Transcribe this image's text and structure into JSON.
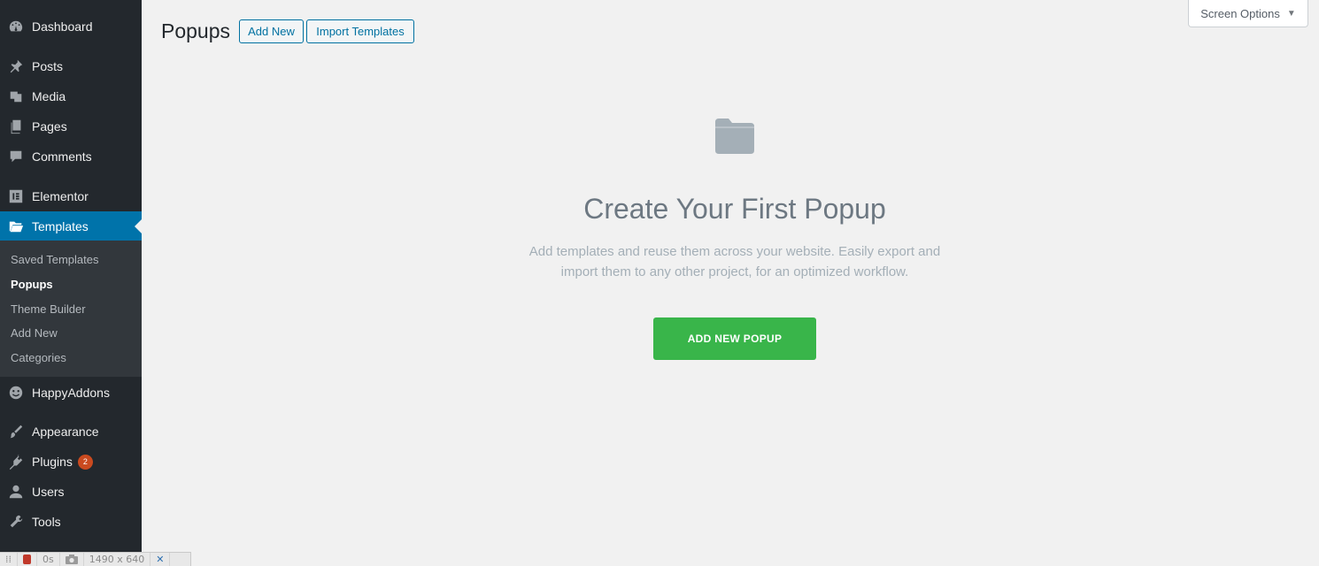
{
  "sidebar": {
    "items": [
      {
        "label": "Dashboard",
        "icon": "dashboard-icon"
      },
      {
        "label": "Posts",
        "icon": "pin-icon"
      },
      {
        "label": "Media",
        "icon": "media-icon"
      },
      {
        "label": "Pages",
        "icon": "pages-icon"
      },
      {
        "label": "Comments",
        "icon": "comment-icon"
      },
      {
        "label": "Elementor",
        "icon": "elementor-icon"
      },
      {
        "label": "Templates",
        "icon": "folder-open-icon",
        "active": true
      },
      {
        "label": "HappyAddons",
        "icon": "happyaddons-icon"
      },
      {
        "label": "Appearance",
        "icon": "brush-icon"
      },
      {
        "label": "Plugins",
        "icon": "plugin-icon",
        "badge": "2"
      },
      {
        "label": "Users",
        "icon": "user-icon"
      },
      {
        "label": "Tools",
        "icon": "wrench-icon"
      }
    ],
    "submenu": [
      {
        "label": "Saved Templates"
      },
      {
        "label": "Popups",
        "current": true
      },
      {
        "label": "Theme Builder"
      },
      {
        "label": "Add New"
      },
      {
        "label": "Categories"
      }
    ]
  },
  "header": {
    "title": "Popups",
    "add_new_label": "Add New",
    "import_label": "Import Templates",
    "screen_options_label": "Screen Options"
  },
  "empty_state": {
    "title": "Create Your First Popup",
    "description_line1": "Add templates and reuse them across your website. Easily export and",
    "description_line2": "import them to any other project, for an optimized workflow.",
    "button_label": "ADD NEW POPUP"
  },
  "recorder": {
    "time": "0s",
    "size": "1490 x 640"
  },
  "colors": {
    "sidebar_bg": "#23282d",
    "active_bg": "#0073aa",
    "submenu_bg": "#32373c",
    "button_green": "#39b54a",
    "badge_red": "#ca4a1f"
  }
}
